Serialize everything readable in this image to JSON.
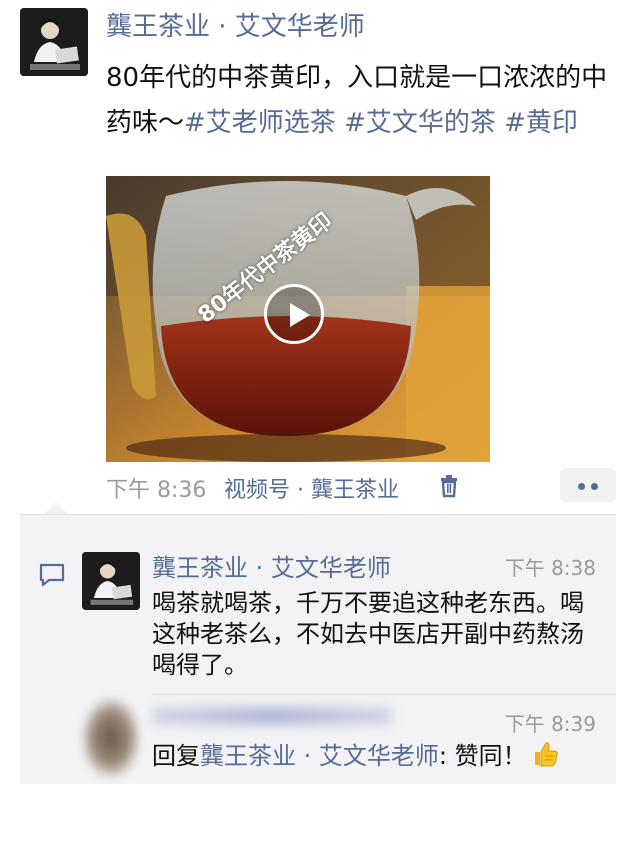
{
  "post": {
    "author": "龔王茶业 · 艾文华老师",
    "text": "80年代的中茶黄印，入口就是一口浓浓的中药味～",
    "tags": [
      "#艾老师选茶",
      "#艾文华的茶",
      "#黄印"
    ],
    "video_overlay_text": "80年代中茶黄印",
    "time": "下午 8:36",
    "channel": "视频号 · 龔王茶业"
  },
  "comments": [
    {
      "author": "龔王茶业 · 艾文华老师",
      "time": "下午 8:38",
      "text": "喝茶就喝茶，千万不要追这种老东西。喝这种老茶么，不如去中医店开副中药熬汤喝得了。"
    },
    {
      "time": "下午 8:39",
      "reply_prefix": "回复",
      "reply_to": "龔王茶业 · 艾文华老师",
      "reply_suffix": ": 赞同！"
    }
  ],
  "icons": {
    "delete": "trash-icon",
    "more": "more-dots-icon",
    "comment": "comment-bubble-icon",
    "emoji": "thumbs-up-icon",
    "play": "play-icon"
  },
  "colors": {
    "link": "#576b95",
    "meta": "#9a9a9a",
    "comment_bg": "#f3f3f5"
  }
}
